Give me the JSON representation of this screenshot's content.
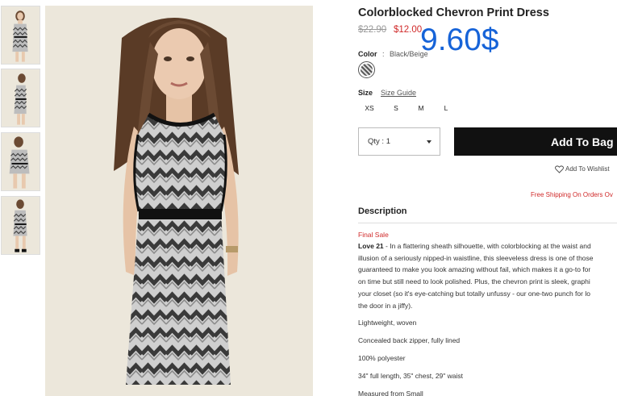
{
  "product": {
    "title": "Colorblocked Chevron Print Dress",
    "price_original": "$22.90",
    "price_sale": "$12.00",
    "overlay_price": "9.60$"
  },
  "color": {
    "label": "Color",
    "separator": ":",
    "value": "Black/Beige"
  },
  "size": {
    "label": "Size",
    "guide_link": "Size Guide",
    "options": [
      "XS",
      "S",
      "M",
      "L"
    ]
  },
  "purchase": {
    "qty_label": "Qty : 1",
    "add_to_bag": "Add To Bag",
    "wishlist": "Add To Wishlist",
    "shipping_note": "Free Shipping On Orders Ov"
  },
  "description": {
    "heading": "Description",
    "final_sale": "Final Sale",
    "brand": "Love 21",
    "lines": [
      " - In a flattering sheath silhouette, with colorblocking at the waist and",
      "illusion of a seriously nipped-in waistline, this sleeveless dress is one of those",
      "guaranteed to make you look amazing without fail, which makes it a go-to for",
      "on time but still need to look polished. Plus, the chevron print is sleek, graphi",
      "your closet (so it's eye-catching but totally unfussy - our one-two punch for lo",
      "the door in a jiffy)."
    ],
    "bullets": [
      "Lightweight, woven",
      "Concealed back zipper, fully lined",
      "100% polyester",
      "34\" full length, 35\" chest, 29\" waist",
      "Measured from Small"
    ]
  },
  "colors": {
    "sale_red": "#d02a2a",
    "overlay_blue": "#1663d8",
    "button_black": "#111111"
  },
  "icons": {
    "wishlist": "heart-outline-icon",
    "qty": "caret-down-icon"
  }
}
